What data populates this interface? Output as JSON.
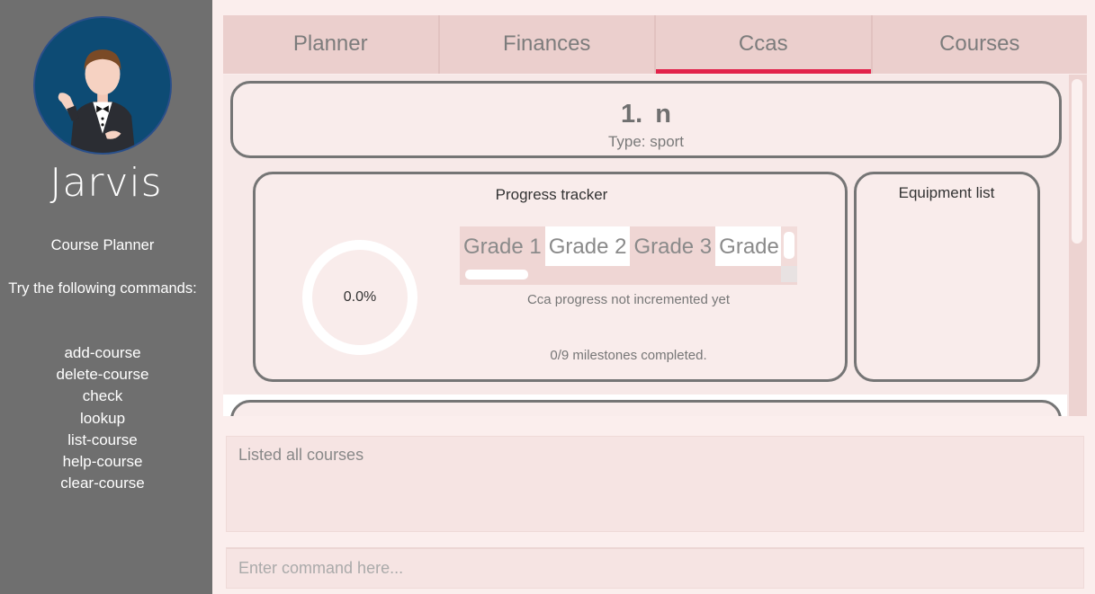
{
  "sidebar": {
    "app_name": "Jarvis",
    "subtitle": "Course Planner",
    "hint": "Try the following commands:",
    "commands": [
      "add-course",
      "delete-course",
      "check",
      "lookup",
      "list-course",
      "help-course",
      "clear-course"
    ]
  },
  "tabs": [
    {
      "label": "Planner",
      "active": false
    },
    {
      "label": "Finances",
      "active": false
    },
    {
      "label": "Ccas",
      "active": true
    },
    {
      "label": "Courses",
      "active": false
    }
  ],
  "cca": {
    "index": "1.",
    "name": "n",
    "type": "Type: sport",
    "progress_heading": "Progress tracker",
    "progress_percent": "0.0%",
    "milestones": [
      "Grade 1",
      "Grade 2",
      "Grade 3",
      "Grade"
    ],
    "status": "Cca progress not incremented yet",
    "milestones_completed": "0/9 milestones completed.",
    "equipment_heading": "Equipment list"
  },
  "result": {
    "text": "Listed all courses"
  },
  "command": {
    "placeholder": "Enter command here..."
  },
  "colors": {
    "sidebar": "#6f6f6f",
    "avatar_bg": "#0d4b74",
    "tab_bar": "#ebcfcd",
    "active_tab_underline": "#e2234b",
    "card_border": "#757575"
  },
  "icons": {
    "avatar": "butler-avatar-icon"
  }
}
